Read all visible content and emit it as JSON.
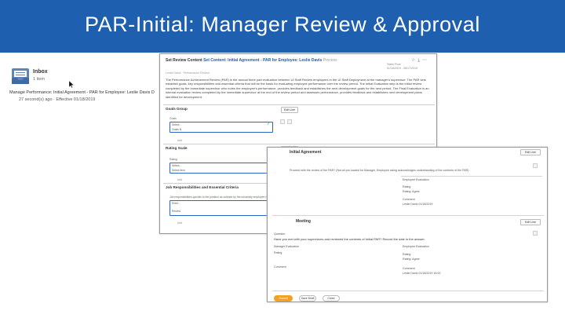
{
  "slide": {
    "title": "PAR-Initial: Manager Review & Approval"
  },
  "colors": {
    "header_blue": "#1f5fb0",
    "accent_orange": "#f4a020",
    "focus_blue": "#2b66c4"
  },
  "inbox": {
    "title": "Inbox",
    "count": "1 item",
    "line1": "Manage Performance: Initial Agreement - PAR for Employee: Leslie Davis D",
    "line2": "27 second(s) ago · Effective 01/18/2019",
    "icon": "inbox-tray-icon"
  },
  "screen1": {
    "heading_prefix": "Set Review Content",
    "heading": "Set Content: Initial Agreement - PAR for Employee: Leslie Davis",
    "heading_suffix": "Process",
    "meta_line1": "Tasks Flow",
    "meta_line2": "01/18/2019 - 08/17/2019",
    "subline": "Leslie Davis · Performance Review",
    "paragraph": "The Performance Achievement Review (PAR) is the annual three part evaluation between UI Staff Review employees in the UI Staff Deployment at the manager's supervisor. The PAR sets establish goals, key responsibilities and essential criteria that will be the basis for evaluating employee performance over the review period. The Initial Evaluation step is the initial review completed by the immediate supervisor who notes the employee's performance, provides feedback and establishes the next development goals for the next period. The Final Evaluation is an internal evaluation review completed by the immediate supervisor at the end of the review period and assesses performance, provides feedback and establishes next development plans identified for development.",
    "sections": [
      {
        "title": "Goals Group",
        "button": "Edit Line",
        "field_label": "Goals",
        "field_value": "Select...",
        "field_sub": "Goals N",
        "add": "Add"
      },
      {
        "title": "Rating Scale",
        "button": "Continue",
        "field_label": "Rating",
        "field_value": "Select...",
        "field_sub": "Select item",
        "add": "Add"
      },
      {
        "title": "Job Responsibilities and Essential Criteria",
        "button": "Edit Line",
        "field_label": "Job responsibilities specific to the position as outlined by the university employee responsibilities",
        "field_value": "Enter...",
        "field_sub": "Review",
        "add": "Add"
      }
    ],
    "icons": [
      "star-icon",
      "export-icon",
      "more-icon"
    ]
  },
  "screen2": {
    "title": "Initial Agreement",
    "top_button": "Edit Line",
    "line1": "Proceed with the review of the PAR? (Not all pre-loaded for Manager, Employee rating acknowledges understanding of the contents of the PAR)",
    "employee_eval_label": "Employee Evaluation",
    "rating_label": "Rating",
    "rating_value": "Rating: Agree",
    "comment_label": "Comment",
    "comment_value": "Leslie Davis 01/18/2019",
    "meeting_title": "Meeting",
    "meeting_button": "Edit Line",
    "question_label": "Question",
    "question_text": "Have you met with your supervisors and reviewed the contents of Initial PAR? Record the date in the answer.",
    "manager_eval_label": "Manager Evaluation",
    "employee_eval_label2": "Employee Evaluation",
    "rating_label2": "Rating",
    "rating_value2": "Rating: Agree",
    "comment_label2": "Comment",
    "comment_value2": "Leslie Davis 01/18/2019 16:00",
    "answer_label": "Rating",
    "comment_label3": "Comment",
    "submit": "Submit",
    "save": "Save Draft",
    "close": "Close"
  }
}
